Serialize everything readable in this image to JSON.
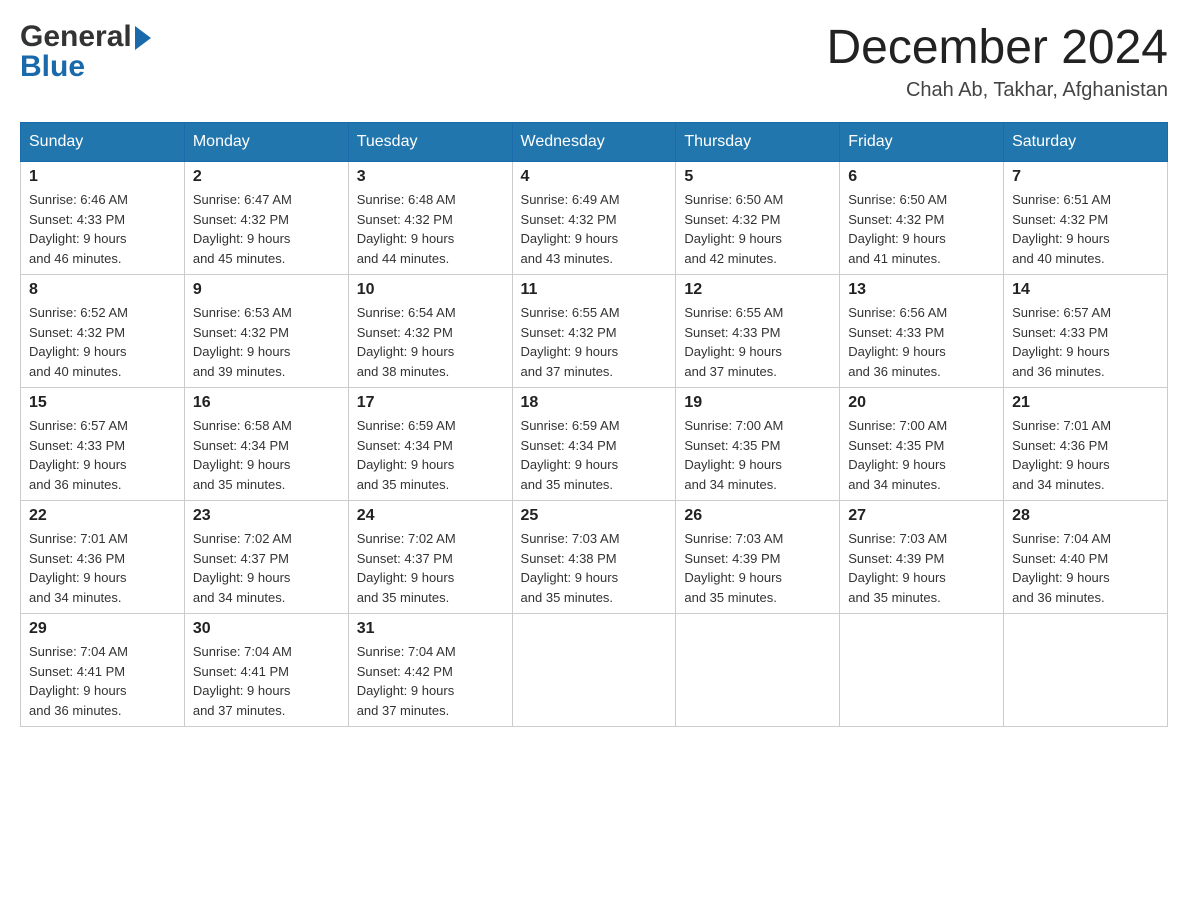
{
  "header": {
    "logo_general": "General",
    "logo_blue": "Blue",
    "month_title": "December 2024",
    "location": "Chah Ab, Takhar, Afghanistan"
  },
  "days_of_week": [
    "Sunday",
    "Monday",
    "Tuesday",
    "Wednesday",
    "Thursday",
    "Friday",
    "Saturday"
  ],
  "weeks": [
    [
      {
        "day": "1",
        "sunrise": "6:46 AM",
        "sunset": "4:33 PM",
        "daylight": "9 hours and 46 minutes."
      },
      {
        "day": "2",
        "sunrise": "6:47 AM",
        "sunset": "4:32 PM",
        "daylight": "9 hours and 45 minutes."
      },
      {
        "day": "3",
        "sunrise": "6:48 AM",
        "sunset": "4:32 PM",
        "daylight": "9 hours and 44 minutes."
      },
      {
        "day": "4",
        "sunrise": "6:49 AM",
        "sunset": "4:32 PM",
        "daylight": "9 hours and 43 minutes."
      },
      {
        "day": "5",
        "sunrise": "6:50 AM",
        "sunset": "4:32 PM",
        "daylight": "9 hours and 42 minutes."
      },
      {
        "day": "6",
        "sunrise": "6:50 AM",
        "sunset": "4:32 PM",
        "daylight": "9 hours and 41 minutes."
      },
      {
        "day": "7",
        "sunrise": "6:51 AM",
        "sunset": "4:32 PM",
        "daylight": "9 hours and 40 minutes."
      }
    ],
    [
      {
        "day": "8",
        "sunrise": "6:52 AM",
        "sunset": "4:32 PM",
        "daylight": "9 hours and 40 minutes."
      },
      {
        "day": "9",
        "sunrise": "6:53 AM",
        "sunset": "4:32 PM",
        "daylight": "9 hours and 39 minutes."
      },
      {
        "day": "10",
        "sunrise": "6:54 AM",
        "sunset": "4:32 PM",
        "daylight": "9 hours and 38 minutes."
      },
      {
        "day": "11",
        "sunrise": "6:55 AM",
        "sunset": "4:32 PM",
        "daylight": "9 hours and 37 minutes."
      },
      {
        "day": "12",
        "sunrise": "6:55 AM",
        "sunset": "4:33 PM",
        "daylight": "9 hours and 37 minutes."
      },
      {
        "day": "13",
        "sunrise": "6:56 AM",
        "sunset": "4:33 PM",
        "daylight": "9 hours and 36 minutes."
      },
      {
        "day": "14",
        "sunrise": "6:57 AM",
        "sunset": "4:33 PM",
        "daylight": "9 hours and 36 minutes."
      }
    ],
    [
      {
        "day": "15",
        "sunrise": "6:57 AM",
        "sunset": "4:33 PM",
        "daylight": "9 hours and 36 minutes."
      },
      {
        "day": "16",
        "sunrise": "6:58 AM",
        "sunset": "4:34 PM",
        "daylight": "9 hours and 35 minutes."
      },
      {
        "day": "17",
        "sunrise": "6:59 AM",
        "sunset": "4:34 PM",
        "daylight": "9 hours and 35 minutes."
      },
      {
        "day": "18",
        "sunrise": "6:59 AM",
        "sunset": "4:34 PM",
        "daylight": "9 hours and 35 minutes."
      },
      {
        "day": "19",
        "sunrise": "7:00 AM",
        "sunset": "4:35 PM",
        "daylight": "9 hours and 34 minutes."
      },
      {
        "day": "20",
        "sunrise": "7:00 AM",
        "sunset": "4:35 PM",
        "daylight": "9 hours and 34 minutes."
      },
      {
        "day": "21",
        "sunrise": "7:01 AM",
        "sunset": "4:36 PM",
        "daylight": "9 hours and 34 minutes."
      }
    ],
    [
      {
        "day": "22",
        "sunrise": "7:01 AM",
        "sunset": "4:36 PM",
        "daylight": "9 hours and 34 minutes."
      },
      {
        "day": "23",
        "sunrise": "7:02 AM",
        "sunset": "4:37 PM",
        "daylight": "9 hours and 34 minutes."
      },
      {
        "day": "24",
        "sunrise": "7:02 AM",
        "sunset": "4:37 PM",
        "daylight": "9 hours and 35 minutes."
      },
      {
        "day": "25",
        "sunrise": "7:03 AM",
        "sunset": "4:38 PM",
        "daylight": "9 hours and 35 minutes."
      },
      {
        "day": "26",
        "sunrise": "7:03 AM",
        "sunset": "4:39 PM",
        "daylight": "9 hours and 35 minutes."
      },
      {
        "day": "27",
        "sunrise": "7:03 AM",
        "sunset": "4:39 PM",
        "daylight": "9 hours and 35 minutes."
      },
      {
        "day": "28",
        "sunrise": "7:04 AM",
        "sunset": "4:40 PM",
        "daylight": "9 hours and 36 minutes."
      }
    ],
    [
      {
        "day": "29",
        "sunrise": "7:04 AM",
        "sunset": "4:41 PM",
        "daylight": "9 hours and 36 minutes."
      },
      {
        "day": "30",
        "sunrise": "7:04 AM",
        "sunset": "4:41 PM",
        "daylight": "9 hours and 37 minutes."
      },
      {
        "day": "31",
        "sunrise": "7:04 AM",
        "sunset": "4:42 PM",
        "daylight": "9 hours and 37 minutes."
      },
      null,
      null,
      null,
      null
    ]
  ],
  "labels": {
    "sunrise": "Sunrise:",
    "sunset": "Sunset:",
    "daylight": "Daylight:"
  }
}
